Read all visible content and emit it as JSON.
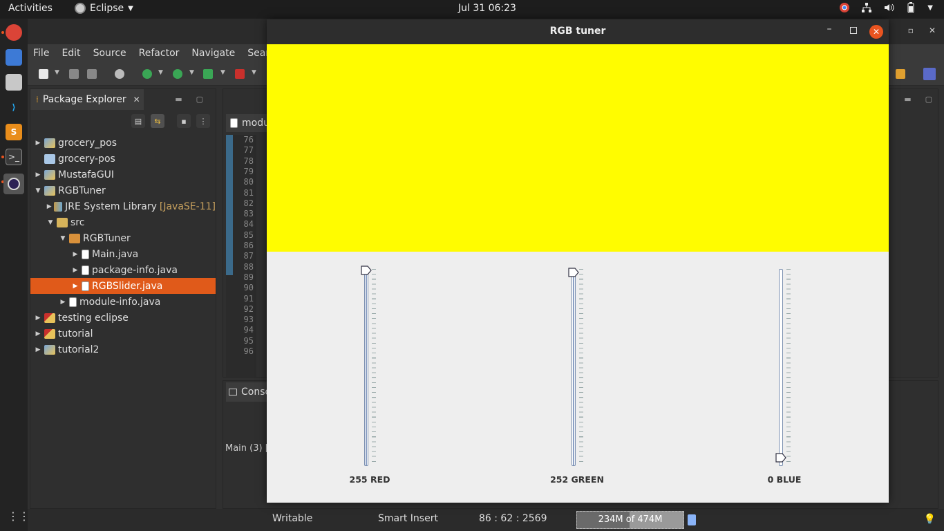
{
  "topbar": {
    "activities": "Activities",
    "app_name": "Eclipse",
    "clock": "Jul 31  06:23"
  },
  "eclipse": {
    "menu": [
      "File",
      "Edit",
      "Source",
      "Refactor",
      "Navigate",
      "Search"
    ],
    "package_explorer": {
      "tab_label": "Package Explorer",
      "tree": [
        {
          "label": "grocery_pos",
          "icon": "project-icon",
          "expanded": false
        },
        {
          "label": "grocery-pos",
          "icon": "folder-icon",
          "expanded": null
        },
        {
          "label": "MustafaGUI",
          "icon": "project-icon",
          "expanded": false
        },
        {
          "label": "RGBTuner",
          "icon": "project-icon",
          "expanded": true
        },
        {
          "label": "JRE System Library",
          "decoration": "[JavaSE-11]",
          "icon": "library-icon",
          "expanded": false
        },
        {
          "label": "src",
          "icon": "source-folder-icon",
          "expanded": true
        },
        {
          "label": "RGBTuner",
          "icon": "package-icon",
          "expanded": true
        },
        {
          "label": "Main.java",
          "icon": "java-file-icon",
          "expanded": false
        },
        {
          "label": "package-info.java",
          "icon": "java-file-icon",
          "expanded": false
        },
        {
          "label": "RGBSlider.java",
          "icon": "java-file-icon",
          "expanded": false,
          "selected": true
        },
        {
          "label": "module-info.java",
          "icon": "java-file-icon",
          "expanded": false
        },
        {
          "label": "testing eclipse",
          "icon": "project-error-icon",
          "expanded": false
        },
        {
          "label": "tutorial",
          "icon": "project-error-icon",
          "expanded": false
        },
        {
          "label": "tutorial2",
          "icon": "project-icon",
          "expanded": false
        }
      ]
    },
    "editor": {
      "tab_label": "modu",
      "line_numbers": [
        "76",
        "77",
        "78",
        "79",
        "80",
        "81",
        "82",
        "83",
        "84",
        "85",
        "86",
        "87",
        "88",
        "89",
        "90",
        "91",
        "92",
        "93",
        "94",
        "95",
        "96"
      ]
    },
    "console": {
      "tab_label": "Conso",
      "launch_label": "Main (3) ["
    },
    "status": {
      "mode": "Writable",
      "insert": "Smart Insert",
      "position": "86 : 62 : 2569",
      "heap": "234M of 474M",
      "heap_fraction": 0.494
    }
  },
  "rgb_tuner": {
    "title": "RGB tuner",
    "preview_color": "#FFFC00",
    "sliders": [
      {
        "channel": "RED",
        "value": 255,
        "max": 255,
        "label": "255 RED"
      },
      {
        "channel": "GREEN",
        "value": 252,
        "max": 255,
        "label": "252 GREEN"
      },
      {
        "channel": "BLUE",
        "value": 0,
        "max": 255,
        "label": "0 BLUE"
      }
    ]
  },
  "colors": {
    "selection": "#e05a1a",
    "ubuntu_orange": "#e95420",
    "dialog_bg": "#eeeeee"
  }
}
